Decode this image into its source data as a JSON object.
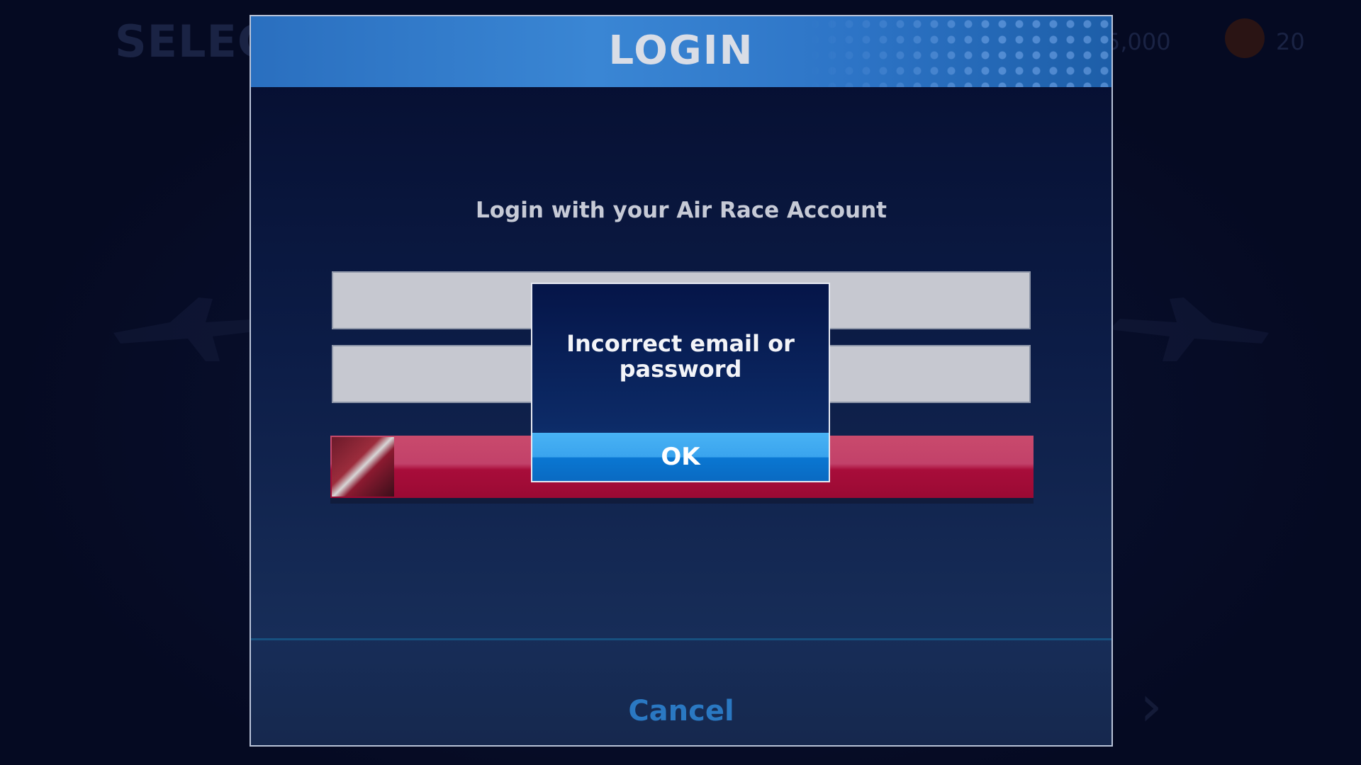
{
  "background": {
    "title": "SELEC",
    "currency": "5,000",
    "level": "20"
  },
  "login": {
    "title": "LOGIN",
    "subtitle": "Login with your Air Race Account",
    "email_field": {
      "value": "",
      "placeholder": ""
    },
    "password_field": {
      "value": "",
      "placeholder": ""
    },
    "redbull_button_icon": "redbull-plane-icon",
    "cancel_label": "Cancel"
  },
  "dialog": {
    "message": "Incorrect email or password",
    "ok_label": "OK"
  },
  "colors": {
    "header_blue": "#3a86d4",
    "redbull_red": "#a80d3a",
    "ok_blue": "#3aa4ee",
    "cancel_blue": "#2a78c2"
  }
}
